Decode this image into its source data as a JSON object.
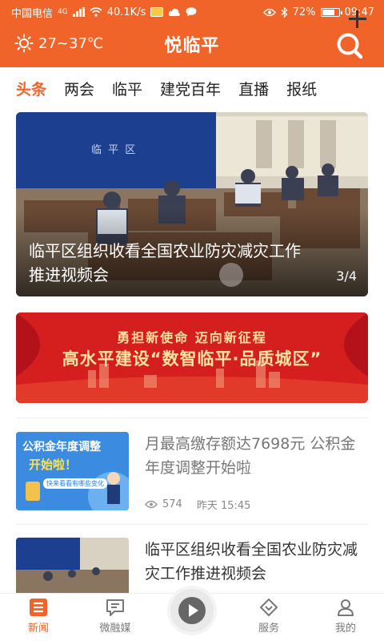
{
  "status_bar": {
    "carrier": "中国电信",
    "network": "4G",
    "speed": "40.1K/s",
    "battery": "72%",
    "time": "09:47"
  },
  "header": {
    "weather": "27~37℃",
    "title": "悦临平"
  },
  "tabs": [
    "头条",
    "两会",
    "临平",
    "建党百年",
    "直播",
    "报纸"
  ],
  "hero": {
    "title": "临平区组织收看全国农业防灾减灾工作推进视频会",
    "counter": "3/4",
    "backdrop_text": "临 平 区"
  },
  "banner": {
    "line1": "勇担新使命  迈向新征程",
    "line2": "高水平建设“数智临平·品质城区”"
  },
  "news": [
    {
      "title": "月最高缴存额达7698元 公积金年度调整开始啦",
      "views": "574",
      "time": "昨天 15:45",
      "thumb_title": "公积金年度调整",
      "thumb_subtitle": "开始啦！",
      "thumb_tag": "快来看看有哪些变化"
    },
    {
      "title": "临平区组织收看全国农业防灾减灾工作推进视频会"
    }
  ],
  "bottom_nav": [
    {
      "label": "新闻"
    },
    {
      "label": "微融媒"
    },
    {
      "label": "服务"
    },
    {
      "label": "我的"
    }
  ],
  "colors": {
    "accent": "#f0642a",
    "banner_red": "#d51e1e",
    "banner_gold": "#ffe3a0"
  }
}
